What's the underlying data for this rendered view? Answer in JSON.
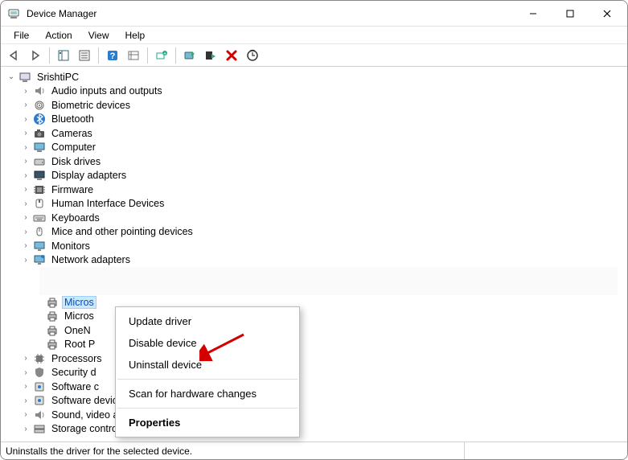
{
  "window": {
    "title": "Device Manager"
  },
  "menubar": {
    "items": [
      "File",
      "Action",
      "View",
      "Help"
    ]
  },
  "toolbar": {
    "icons": [
      "back-arrow-icon",
      "forward-arrow-icon",
      "sep",
      "show-hide-tree-icon",
      "properties-icon",
      "sep",
      "help-icon",
      "show-hidden-icon",
      "sep",
      "add-legacy-icon",
      "sep",
      "update-driver-icon",
      "disable-device-icon",
      "uninstall-device-icon",
      "scan-hardware-icon"
    ]
  },
  "tree": {
    "root": {
      "label": "SrishtiPC",
      "expanded": true
    },
    "categories": [
      {
        "label": "Audio inputs and outputs",
        "icon": "audio-icon",
        "expanded": false
      },
      {
        "label": "Biometric devices",
        "icon": "biometric-icon",
        "expanded": false
      },
      {
        "label": "Bluetooth",
        "icon": "bluetooth-icon",
        "expanded": false
      },
      {
        "label": "Cameras",
        "icon": "camera-icon",
        "expanded": false
      },
      {
        "label": "Computer",
        "icon": "computer-icon",
        "expanded": false
      },
      {
        "label": "Disk drives",
        "icon": "disk-icon",
        "expanded": false
      },
      {
        "label": "Display adapters",
        "icon": "display-icon",
        "expanded": false
      },
      {
        "label": "Firmware",
        "icon": "firmware-icon",
        "expanded": false
      },
      {
        "label": "Human Interface Devices",
        "icon": "hid-icon",
        "expanded": false
      },
      {
        "label": "Keyboards",
        "icon": "keyboard-icon",
        "expanded": false
      },
      {
        "label": "Mice and other pointing devices",
        "icon": "mouse-icon",
        "expanded": false
      },
      {
        "label": "Monitors",
        "icon": "monitor-icon",
        "expanded": false
      },
      {
        "label": "Network adapters",
        "icon": "network-icon",
        "expanded": false
      }
    ],
    "printer_children": [
      {
        "label": "Micros",
        "icon": "printer-icon",
        "selected": true
      },
      {
        "label": "Micros",
        "icon": "printer-icon"
      },
      {
        "label": "OneN",
        "icon": "printer-icon"
      },
      {
        "label": "Root P",
        "icon": "printer-icon"
      }
    ],
    "after_categories": [
      {
        "label": "Processors",
        "icon": "cpu-icon",
        "expanded": false,
        "clipped": true
      },
      {
        "label": "Security d",
        "icon": "security-icon",
        "expanded": false,
        "clipped": true
      },
      {
        "label": "Software c",
        "icon": "software-icon",
        "expanded": false,
        "clipped": true
      },
      {
        "label": "Software devices",
        "icon": "software-icon",
        "expanded": false,
        "clipped": false,
        "tail": "..."
      },
      {
        "label": "Sound, video and game controllers",
        "icon": "sound-icon",
        "expanded": false
      },
      {
        "label": "Storage controllers",
        "icon": "storage-icon",
        "expanded": false
      }
    ]
  },
  "context_menu": {
    "items": [
      {
        "label": "Update driver"
      },
      {
        "label": "Disable device"
      },
      {
        "label": "Uninstall device"
      },
      {
        "type": "sep"
      },
      {
        "label": "Scan for hardware changes"
      },
      {
        "type": "sep"
      },
      {
        "label": "Properties",
        "bold": true
      }
    ]
  },
  "statusbar": {
    "text": "Uninstalls the driver for the selected device."
  },
  "annotation": {
    "arrow_points_to": "Uninstall device",
    "arrow_color": "#d40000"
  }
}
